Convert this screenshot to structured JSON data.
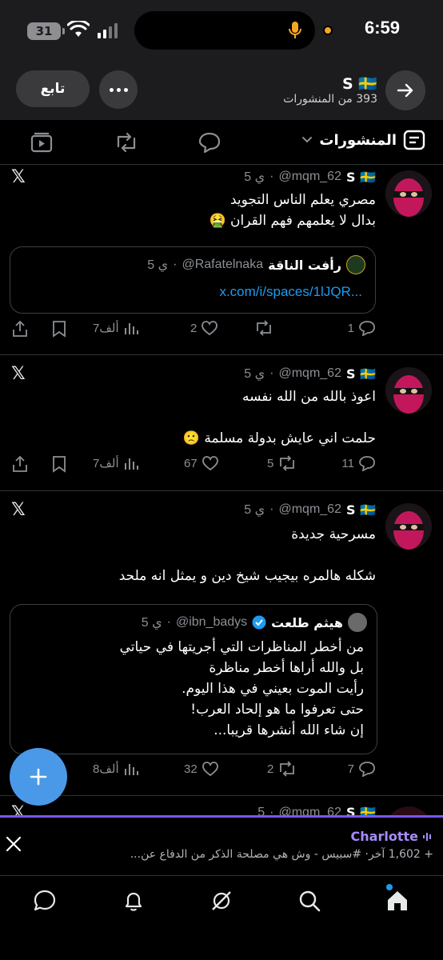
{
  "status_bar": {
    "battery": "31",
    "time": "6:59"
  },
  "header": {
    "follow_label": "تابع",
    "profile_name": "S 🇸🇪",
    "posts_count_text": "393 من المنشورات"
  },
  "tabs": {
    "active_label": "المنشورات"
  },
  "posts": [
    {
      "name": "S 🇸🇪",
      "handle": "@mqm_62",
      "time": "5 ي",
      "lines": [
        "مصري يعلم الناس التجويد",
        "بدال لا يعلمهم فهم القران 🤮"
      ],
      "quote": {
        "name": "رأفت الناقة",
        "handle": "@Rafatelnaka",
        "time": "5 ي",
        "link": "x.com/i/spaces/1lJQR..."
      },
      "replies": "1",
      "reposts": "",
      "likes": "2",
      "views": "7ألف"
    },
    {
      "name": "S 🇸🇪",
      "handle": "@mqm_62",
      "time": "5 ي",
      "lines": [
        "اعوذ بالله من الله نفسه",
        "",
        "حلمت اني عايش بدولة مسلمة 🙁"
      ],
      "replies": "11",
      "reposts": "5",
      "likes": "67",
      "views": "7ألف"
    },
    {
      "name": "S 🇸🇪",
      "handle": "@mqm_62",
      "time": "5 ي",
      "lines": [
        "مسرحية جديدة",
        "",
        "شكله هالمره بيجيب شيخ دين و يمثل انه ملحد"
      ],
      "quote": {
        "name": "هيثم طلعت",
        "handle": "@ibn_badys",
        "time": "5 ي",
        "lines": [
          "من أخطر المناظرات التي أجريتها في حياتي",
          "بل والله أراها أخطر مناظرة",
          "رأيت الموت بعيني في هذا اليوم.",
          "حتى تعرفوا ما هو إلحاد العرب!",
          "إن شاء الله أنشرها قريبا..."
        ]
      },
      "replies": "7",
      "reposts": "2",
      "likes": "32",
      "views": "8ألف"
    }
  ],
  "partial_post": {
    "name": "S 🇸🇪",
    "handle": "@mqm_62",
    "time": "5"
  },
  "spaces_bar": {
    "host": "Charlotte",
    "meta": "+ 1,602 آخر· #سبيس - وش هي مصلحة الذكر من الدفاع عن..."
  },
  "colors": {
    "accent": "#1d9bf0",
    "spaces": "#7856ff",
    "fab": "#4a99e9"
  }
}
